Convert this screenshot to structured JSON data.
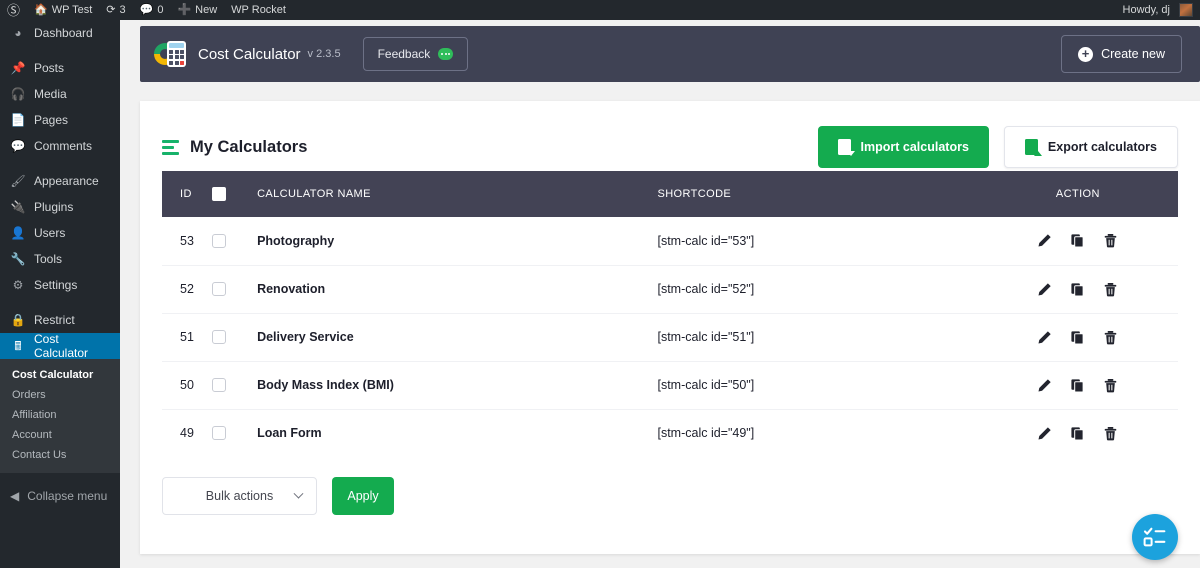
{
  "adminbar": {
    "logo_icon": "wordpress-logo-icon",
    "site": {
      "label": "WP Test",
      "icon": "home-icon"
    },
    "updates": {
      "count": "3",
      "icon": "updates-icon"
    },
    "comments": {
      "count": "0",
      "icon": "comment-icon"
    },
    "new": {
      "label": "New",
      "icon": "plus-icon"
    },
    "wp_rocket": {
      "label": "WP Rocket"
    },
    "account": {
      "greeting": "Howdy, dj"
    }
  },
  "sidebar": {
    "items": [
      {
        "label": "Dashboard",
        "icon": "dashboard-icon"
      },
      {
        "label": "Posts",
        "icon": "pin-icon"
      },
      {
        "label": "Media",
        "icon": "media-icon"
      },
      {
        "label": "Pages",
        "icon": "page-icon"
      },
      {
        "label": "Comments",
        "icon": "comment-icon"
      },
      {
        "label": "Appearance",
        "icon": "brush-icon"
      },
      {
        "label": "Plugins",
        "icon": "plug-icon"
      },
      {
        "label": "Users",
        "icon": "user-icon"
      },
      {
        "label": "Tools",
        "icon": "wrench-icon"
      },
      {
        "label": "Settings",
        "icon": "settings-icon"
      },
      {
        "label": "Restrict",
        "icon": "lock-icon"
      },
      {
        "label": "Cost Calculator",
        "icon": "calculator-icon"
      }
    ],
    "submenu": [
      {
        "label": "Cost Calculator",
        "current": true
      },
      {
        "label": "Orders",
        "current": false
      },
      {
        "label": "Affiliation",
        "current": false
      },
      {
        "label": "Account",
        "current": false
      },
      {
        "label": "Contact Us",
        "current": false
      }
    ],
    "collapse": {
      "label": "Collapse menu",
      "icon": "collapse-arrow-icon"
    },
    "current_item": "Cost Calculator"
  },
  "plugin_header": {
    "logo_icon": "cost-calculator-logo-icon",
    "title": "Cost Calculator",
    "version": "v 2.3.5",
    "feedback_label": "Feedback",
    "feedback_icon": "chat-bubble-icon",
    "create_label": "Create new",
    "create_icon": "plus-circle-icon",
    "background": "#3f4254"
  },
  "card": {
    "title": "My Calculators",
    "title_icon": "menu-bars-icon",
    "import_label": "Import calculators",
    "import_icon": "file-import-icon",
    "export_label": "Export calculators",
    "export_icon": "file-export-icon",
    "accent_green": "#14ab4f",
    "header_background": "#434355"
  },
  "table": {
    "columns": [
      "ID",
      "",
      "CALCULATOR NAME",
      "SHORTCODE",
      "ACTION"
    ],
    "select_all_icon": "checkbox-icon",
    "rows": [
      {
        "id": "53",
        "name": "Photography",
        "shortcode": "[stm-calc id=\"53\"]"
      },
      {
        "id": "52",
        "name": "Renovation",
        "shortcode": "[stm-calc id=\"52\"]"
      },
      {
        "id": "51",
        "name": "Delivery Service",
        "shortcode": "[stm-calc id=\"51\"]"
      },
      {
        "id": "50",
        "name": "Body Mass Index (BMI)",
        "shortcode": "[stm-calc id=\"50\"]"
      },
      {
        "id": "49",
        "name": "Loan Form",
        "shortcode": "[stm-calc id=\"49\"]"
      }
    ],
    "row_actions": [
      {
        "name": "edit-icon",
        "title": "Edit"
      },
      {
        "name": "duplicate-icon",
        "title": "Duplicate"
      },
      {
        "name": "delete-icon",
        "title": "Delete"
      }
    ]
  },
  "footer": {
    "bulk_actions_label": "Bulk actions",
    "bulk_chevron_icon": "chevron-down-icon",
    "apply_label": "Apply"
  },
  "fab": {
    "icon": "checklist-icon",
    "color": "#1ca2dd"
  }
}
